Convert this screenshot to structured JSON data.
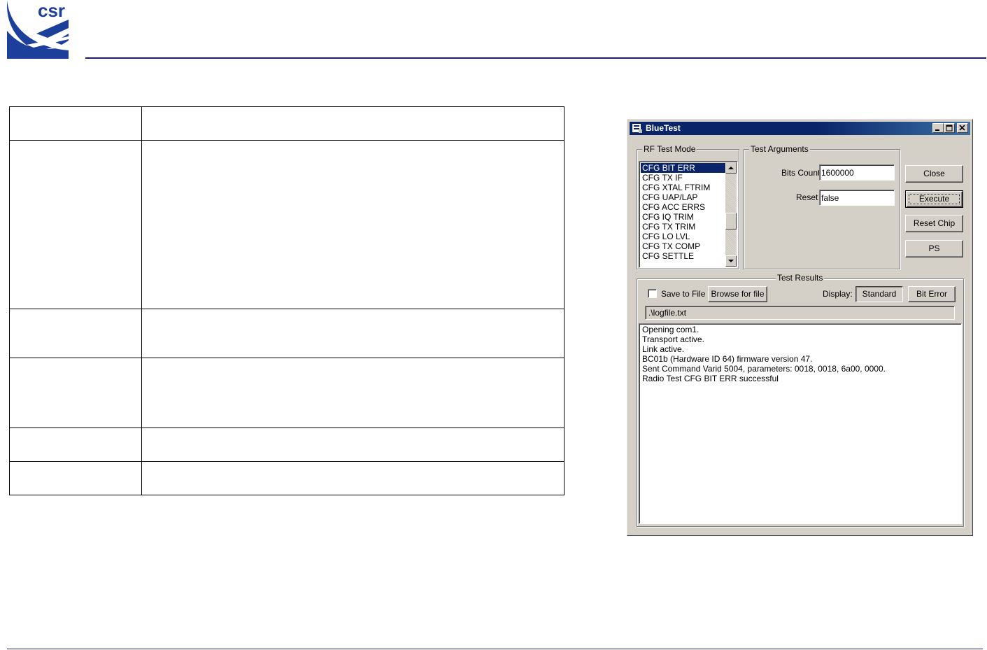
{
  "brand": {
    "logo_text": "csr",
    "accent_color": "#1a1a6e"
  },
  "window": {
    "title": "BlueTest",
    "rf_test_mode": {
      "label": "RF Test Mode",
      "items": [
        "CFG BIT ERR",
        "CFG TX IF",
        "CFG XTAL FTRIM",
        "CFG UAP/LAP",
        "CFG ACC ERRS",
        "CFG IQ TRIM",
        "CFG TX TRIM",
        "CFG LO LVL",
        "CFG TX COMP",
        "CFG SETTLE"
      ],
      "selected": "CFG BIT ERR"
    },
    "test_arguments": {
      "label": "Test Arguments",
      "bits_count_label": "Bits Count",
      "bits_count_value": "1600000",
      "reset_label": "Reset",
      "reset_value": "false"
    },
    "buttons": {
      "close": "Close",
      "execute": "Execute",
      "reset_chip": "Reset Chip",
      "ps": "PS"
    },
    "test_results": {
      "label": "Test Results",
      "save_to_file_label": "Save to File",
      "save_to_file_checked": false,
      "browse_label": "Browse for file",
      "display_label": "Display:",
      "standard_label": "Standard",
      "bit_error_label": "Bit Error",
      "file_path": ".\\logfile.txt",
      "log_lines": [
        "Opening com1.",
        "Transport active.",
        "Link active.",
        "BC01b (Hardware ID 64) firmware version 47.",
        "Sent Command Varid 5004, parameters: 0018, 0018, 6a00, 0000.",
        "Radio Test CFG BIT ERR successful"
      ]
    }
  }
}
